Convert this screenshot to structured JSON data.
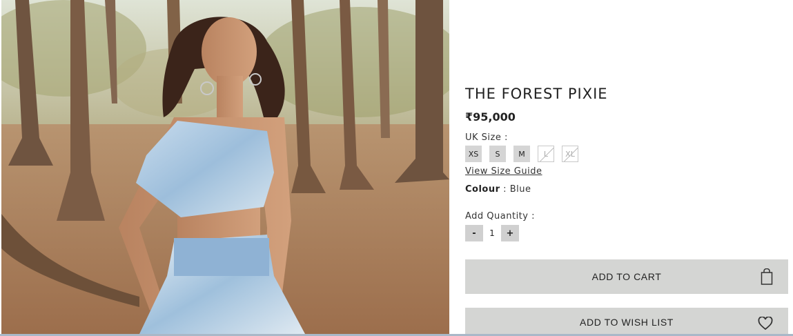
{
  "product": {
    "title": "THE FOREST PIXIE",
    "price": "₹95,000",
    "image_alt": "Model wearing blue tie-dye draped top and printed skirt in a forest"
  },
  "size": {
    "label": "UK Size  :",
    "options": [
      {
        "label": "XS",
        "available": true
      },
      {
        "label": "S",
        "available": true
      },
      {
        "label": "M",
        "available": true
      },
      {
        "label": "L",
        "available": false
      },
      {
        "label": "XL",
        "available": false
      }
    ],
    "guide_link": "View Size Guide"
  },
  "colour": {
    "label": "Colour",
    "separator": ":",
    "value": "Blue"
  },
  "quantity": {
    "label": "Add Quantity :",
    "minus": "-",
    "value": "1",
    "plus": "+"
  },
  "actions": {
    "add_to_cart": "ADD TO CART",
    "add_to_wish_list": "ADD TO WISH LIST"
  },
  "icons": {
    "cart": "shopping-bag-icon",
    "wish": "heart-icon"
  },
  "colors": {
    "button_bg": "#d4d5d3",
    "size_bg": "#d5d5d5"
  }
}
